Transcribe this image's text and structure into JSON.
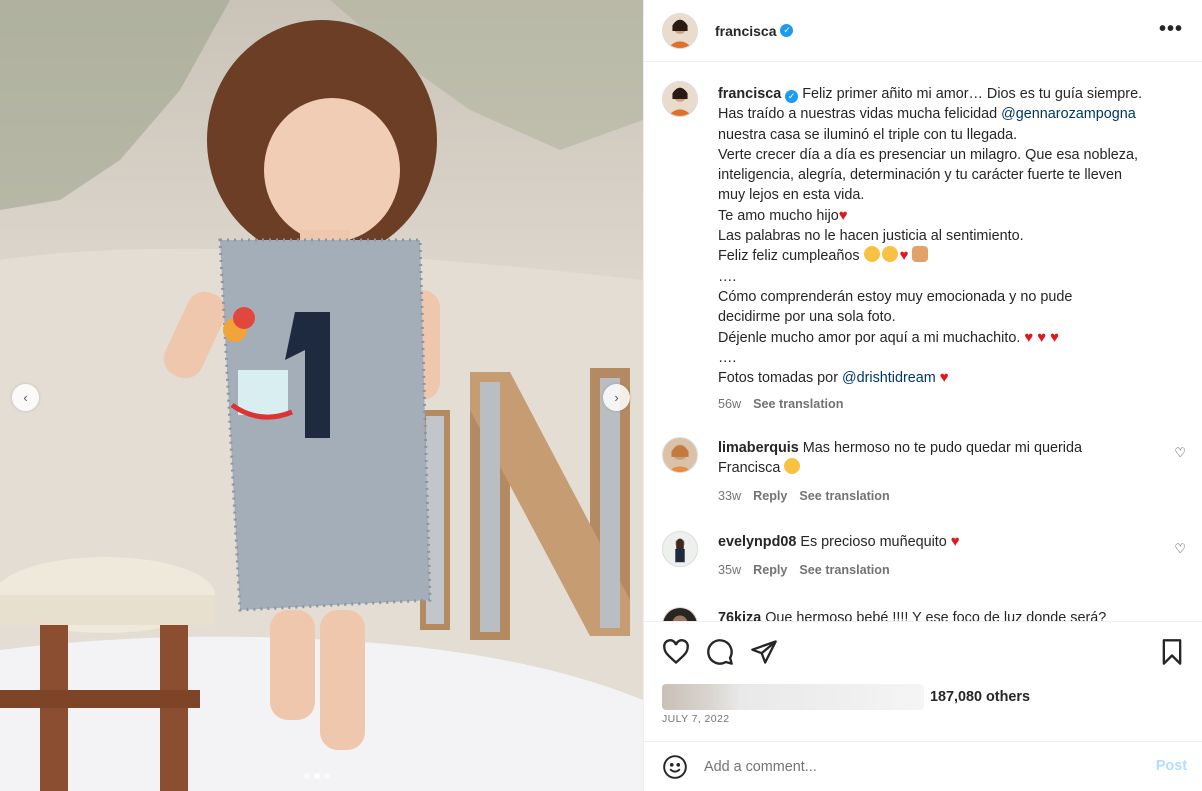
{
  "header": {
    "username": "francisca",
    "more_label": "•••"
  },
  "carousel": {
    "prev_label": "‹",
    "next_label": "›",
    "slide_count": 3,
    "active_slide": 2
  },
  "caption": {
    "username": "francisca",
    "lines": [
      "Feliz primer añito mi amor… Dios es tu guía siempre.",
      "Has traído a nuestras vidas mucha felicidad",
      "nuestra casa se iluminó el triple con tu llegada.",
      "Verte crecer día a día es presenciar un milagro. Que esa nobleza,",
      "inteligencia, alegría, determinación y tu carácter fuerte te lleven",
      "muy lejos en esta vida.",
      "Te amo mucho hijo",
      "Las palabras no le hacen justicia al sentimiento.",
      "Feliz feliz cumpleaños",
      "….",
      "Cómo comprenderán estoy muy emocionada y no pude",
      "decidirme por una sola foto.",
      "Déjenle mucho amor por aquí a mi muchachito.",
      "….",
      "Fotos tomadas por"
    ],
    "mention_1": "@gennarozampogna",
    "mention_2": "@drishtidream",
    "time": "56w",
    "see_translation": "See translation"
  },
  "comments": [
    {
      "username": "limaberquis",
      "text": "Mas hermoso no te pudo quedar mi querida",
      "text2": "Francisca",
      "time": "33w",
      "reply": "Reply",
      "see_translation": "See translation"
    },
    {
      "username": "evelynpd08",
      "text": "Es precioso muñequito",
      "time": "35w",
      "reply": "Reply",
      "see_translation": "See translation"
    },
    {
      "username": "76kiza",
      "text": "Que hermoso bebé !!!! Y ese foco de luz donde será?"
    }
  ],
  "likes": {
    "count_text": "187,080 others"
  },
  "post_date": "JULY 7, 2022",
  "add_comment": {
    "placeholder": "Add a comment...",
    "post_label": "Post"
  },
  "colors": {
    "verified": "#1d9bf0",
    "mention": "#00376b",
    "heart": "#e0181d",
    "post_disabled": "#b2dffc"
  }
}
